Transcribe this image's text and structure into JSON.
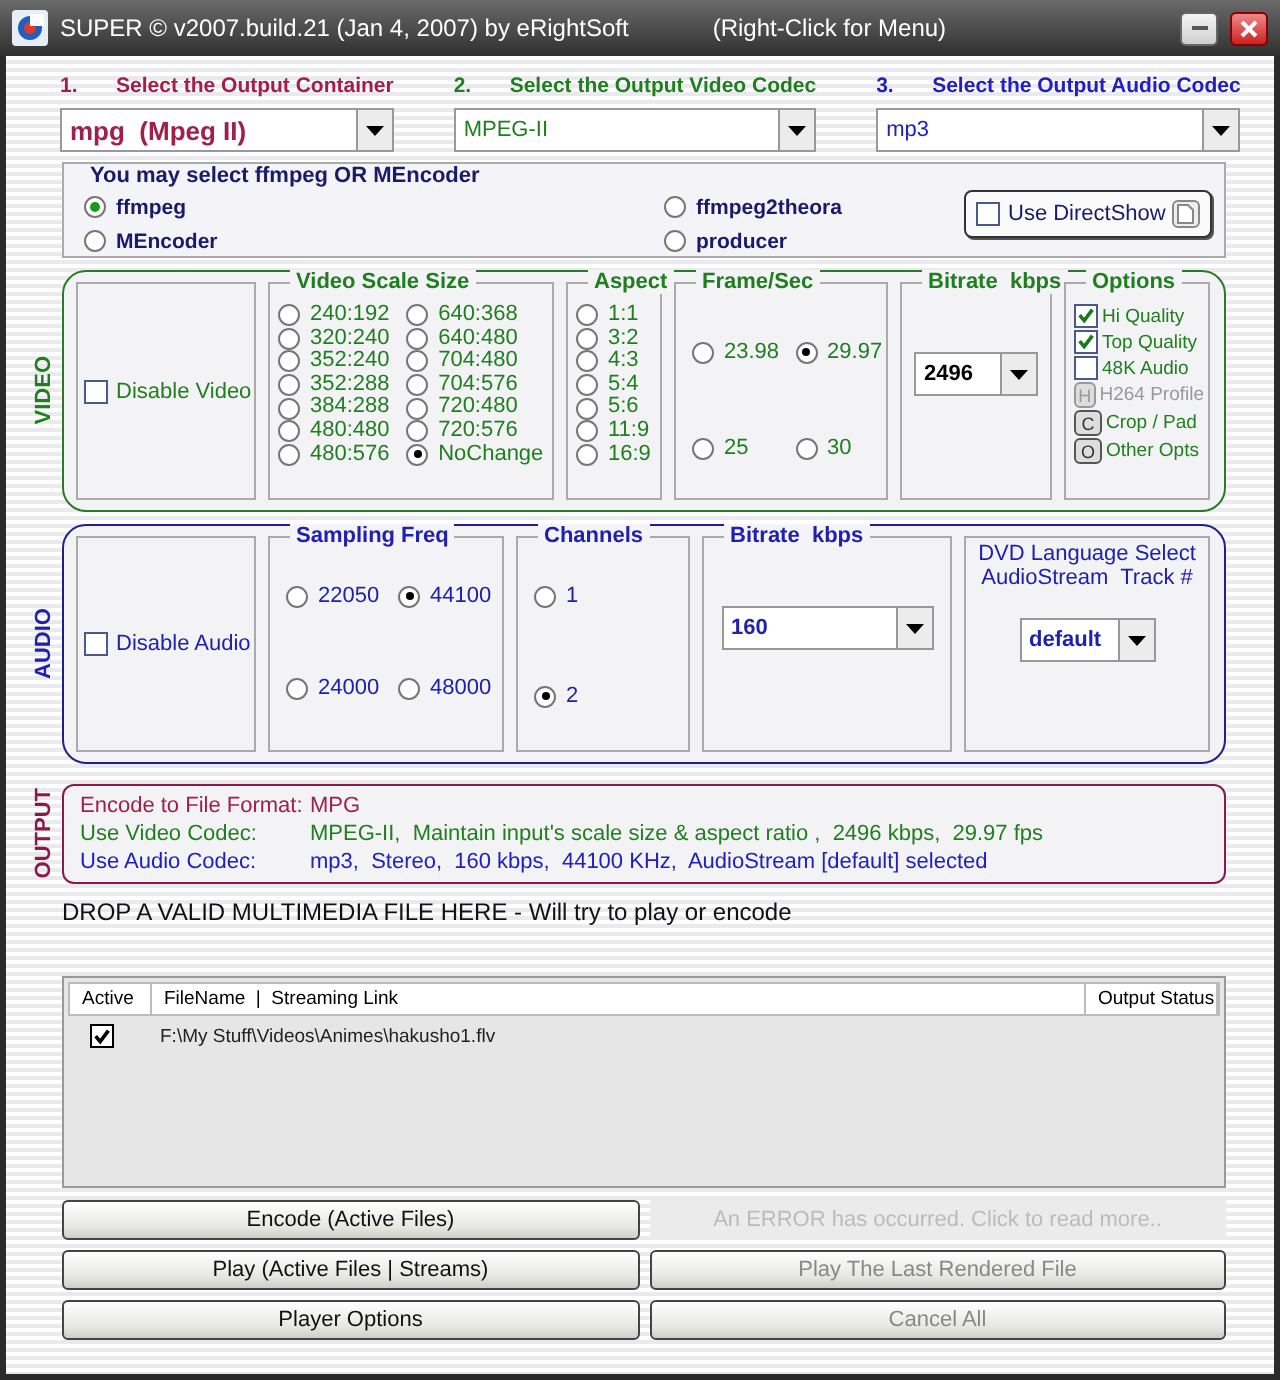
{
  "window": {
    "title": "SUPER © v2007.build.21 (Jan 4, 2007) by eRightSoft",
    "hint": "(Right-Click for Menu)"
  },
  "steps": [
    {
      "number": "1.",
      "label": "Select the Output Container",
      "value": "mpg  (Mpeg II)",
      "color": "#a0204a"
    },
    {
      "number": "2.",
      "label": "Select the Output Video Codec",
      "value": "MPEG-II",
      "color": "#1f7f1f"
    },
    {
      "number": "3.",
      "label": "Select the Output Audio Codec",
      "value": "mp3",
      "color": "#2020c0"
    }
  ],
  "engine": {
    "title": "You may select ffmpeg OR MEncoder",
    "options": [
      {
        "label": "ffmpeg",
        "selected": true
      },
      {
        "label": "ffmpeg2theora",
        "selected": false
      },
      {
        "label": "MEncoder",
        "selected": false
      },
      {
        "label": "producer",
        "selected": false
      }
    ],
    "directshow": {
      "label": "Use DirectShow",
      "checked": false
    }
  },
  "video": {
    "section": "VIDEO",
    "disable": {
      "label": "Disable Video",
      "checked": false
    },
    "scale": {
      "title": "Video Scale Size",
      "options": [
        {
          "label": "240:192",
          "selected": false
        },
        {
          "label": "640:368",
          "selected": false
        },
        {
          "label": "320:240",
          "selected": false
        },
        {
          "label": "640:480",
          "selected": false
        },
        {
          "label": "352:240",
          "selected": false
        },
        {
          "label": "704:480",
          "selected": false
        },
        {
          "label": "352:288",
          "selected": false
        },
        {
          "label": "704:576",
          "selected": false
        },
        {
          "label": "384:288",
          "selected": false
        },
        {
          "label": "720:480",
          "selected": false
        },
        {
          "label": "480:480",
          "selected": false
        },
        {
          "label": "720:576",
          "selected": false
        },
        {
          "label": "480:576",
          "selected": false
        },
        {
          "label": "NoChange",
          "selected": true
        }
      ]
    },
    "aspect": {
      "title": "Aspect",
      "options": [
        {
          "label": "1:1",
          "selected": false
        },
        {
          "label": "3:2",
          "selected": false
        },
        {
          "label": "4:3",
          "selected": false
        },
        {
          "label": "5:4",
          "selected": false
        },
        {
          "label": "5:6",
          "selected": false
        },
        {
          "label": "11:9",
          "selected": false
        },
        {
          "label": "16:9",
          "selected": false
        }
      ]
    },
    "fps": {
      "title": "Frame/Sec",
      "options": [
        {
          "label": "23.98",
          "selected": false
        },
        {
          "label": "29.97",
          "selected": true
        },
        {
          "label": "25",
          "selected": false
        },
        {
          "label": "30",
          "selected": false
        }
      ]
    },
    "bitrate": {
      "title": "Bitrate  kbps",
      "value": "2496"
    },
    "options": {
      "title": "Options",
      "items": [
        {
          "kind": "checkbox",
          "label": "Hi Quality",
          "checked": true
        },
        {
          "kind": "checkbox",
          "label": "Top Quality",
          "checked": true
        },
        {
          "kind": "checkbox",
          "label": "48K Audio",
          "checked": false
        },
        {
          "kind": "button",
          "key": "H",
          "label": "H264 Profile",
          "disabled": true
        },
        {
          "kind": "button",
          "key": "C",
          "label": "Crop / Pad",
          "disabled": false
        },
        {
          "kind": "button",
          "key": "O",
          "label": "Other Opts",
          "disabled": false
        }
      ]
    }
  },
  "audio": {
    "section": "AUDIO",
    "disable": {
      "label": "Disable Audio",
      "checked": false
    },
    "sampling": {
      "title": "Sampling Freq",
      "options": [
        {
          "label": "22050",
          "selected": false
        },
        {
          "label": "44100",
          "selected": true
        },
        {
          "label": "24000",
          "selected": false
        },
        {
          "label": "48000",
          "selected": false
        }
      ]
    },
    "channels": {
      "title": "Channels",
      "options": [
        {
          "label": "1",
          "selected": false
        },
        {
          "label": "2",
          "selected": true
        }
      ]
    },
    "bitrate": {
      "title": "Bitrate  kbps",
      "value": "160"
    },
    "language": {
      "title_lines": [
        "DVD Language Select",
        "AudioStream  Track #"
      ],
      "value": "default"
    }
  },
  "output": {
    "section": "OUTPUT",
    "lines": [
      {
        "label": "Encode to File Format:",
        "value": "MPG",
        "color": "#a0204a"
      },
      {
        "label": "Use Video Codec:",
        "value": "MPEG-II,  Maintain input's scale size & aspect ratio ,  2496 kbps,  29.97 fps",
        "color": "#1f7f1f"
      },
      {
        "label": "Use Audio Codec:",
        "value": "mp3,  Stereo,  160 kbps,  44100 KHz,  AudioStream [default] selected",
        "color": "#2020c0"
      }
    ]
  },
  "drop_hint": "DROP A VALID MULTIMEDIA FILE HERE - Will try to play or encode",
  "files": {
    "columns": [
      "Active",
      "FileName  |  Streaming Link",
      "Output Status"
    ],
    "rows": [
      {
        "active": true,
        "name": "F:\\My Stuff\\Videos\\Animes\\hakusho1.flv"
      }
    ]
  },
  "buttons": [
    {
      "kind": "button",
      "label": "Encode (Active Files)",
      "disabled": false
    },
    {
      "kind": "notice",
      "label": "An ERROR has occurred. Click to read more..",
      "disabled": true
    },
    {
      "kind": "button",
      "label": "Play (Active Files | Streams)",
      "disabled": false
    },
    {
      "kind": "button",
      "label": "Play The Last Rendered File",
      "disabled": true
    },
    {
      "kind": "button",
      "label": "Player Options",
      "disabled": false
    },
    {
      "kind": "button",
      "label": "Cancel All",
      "disabled": true
    }
  ]
}
